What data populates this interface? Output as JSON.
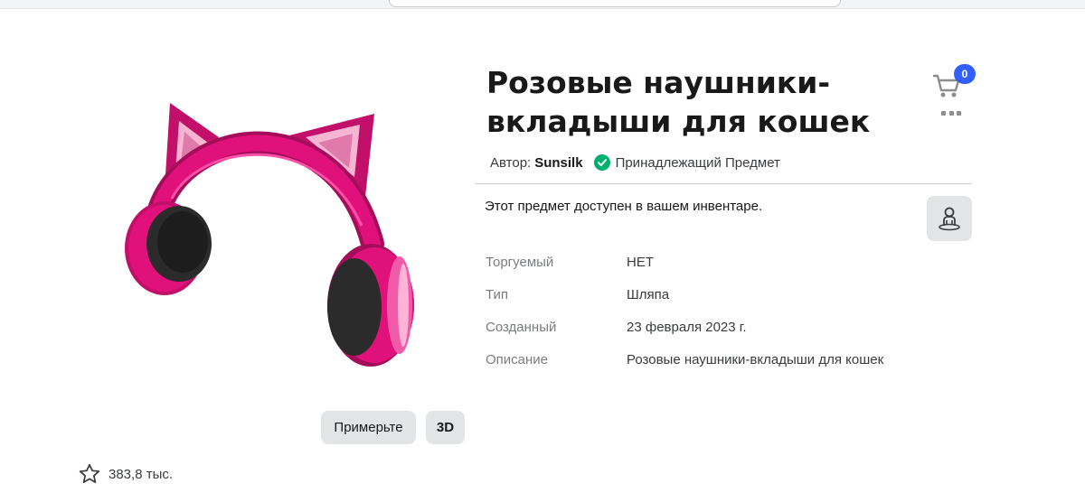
{
  "item": {
    "title": "Розовые наушники-вкладыши для кошек",
    "author_label": "Автор:",
    "creator": "Sunsilk",
    "ownership": "Принадлежащий Предмет",
    "owned_message": "Этот предмет доступен в вашем инвентаре.",
    "image_icon": "pink-cat-ear-headphones"
  },
  "cart": {
    "count": "0",
    "icon": "cart-icon"
  },
  "details": [
    {
      "label": "Торгуемый",
      "value": "НЕТ"
    },
    {
      "label": "Тип",
      "value": "Шляпа"
    },
    {
      "label": "Созданный",
      "value": "23 февраля 2023 г."
    },
    {
      "label": "Описание",
      "value": "Розовые наушники-вкладыши для кошек"
    }
  ],
  "buttons": {
    "try_on": "Примерьте",
    "three_d": "3D"
  },
  "favorites": {
    "count": "383,8 тыс.",
    "icon": "star-icon"
  },
  "colors": {
    "accent_blue": "#335fff",
    "verified_green": "#00b06f",
    "headphone_pink": "#e0117a"
  }
}
